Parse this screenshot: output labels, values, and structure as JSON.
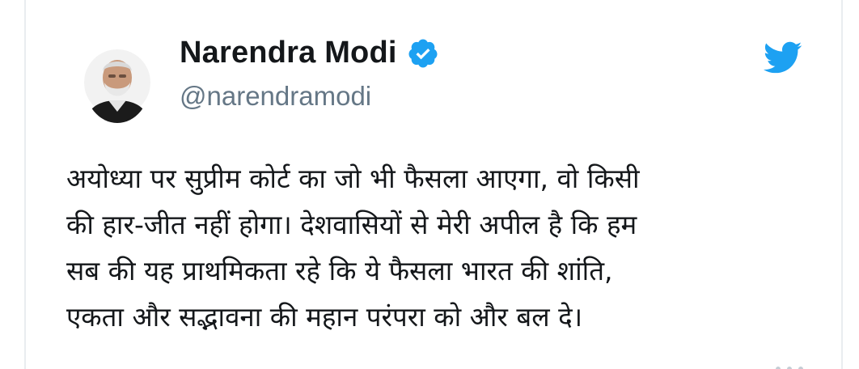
{
  "tweet": {
    "author": {
      "display_name": "Narendra Modi",
      "handle": "@narendramodi",
      "verified": true,
      "avatar": "avatar-portrait"
    },
    "platform_icon": "twitter-bird-icon",
    "text_lines": [
      "अयोध्या पर सुप्रीम कोर्ट का जो भी फैसला आएगा, वो किसी",
      "की हार-जीत नहीं होगा। देशवासियों से मेरी अपील है कि हम",
      "सब की यह प्राथमिकता रहे कि ये फैसला भारत की शांति,",
      "एकता और सद्भावना की महान परंपरा को और बल दे।"
    ]
  },
  "colors": {
    "twitter_blue": "#1da1f2",
    "name_text": "#14171a",
    "handle_text": "#657786",
    "border": "#e9edf0"
  }
}
